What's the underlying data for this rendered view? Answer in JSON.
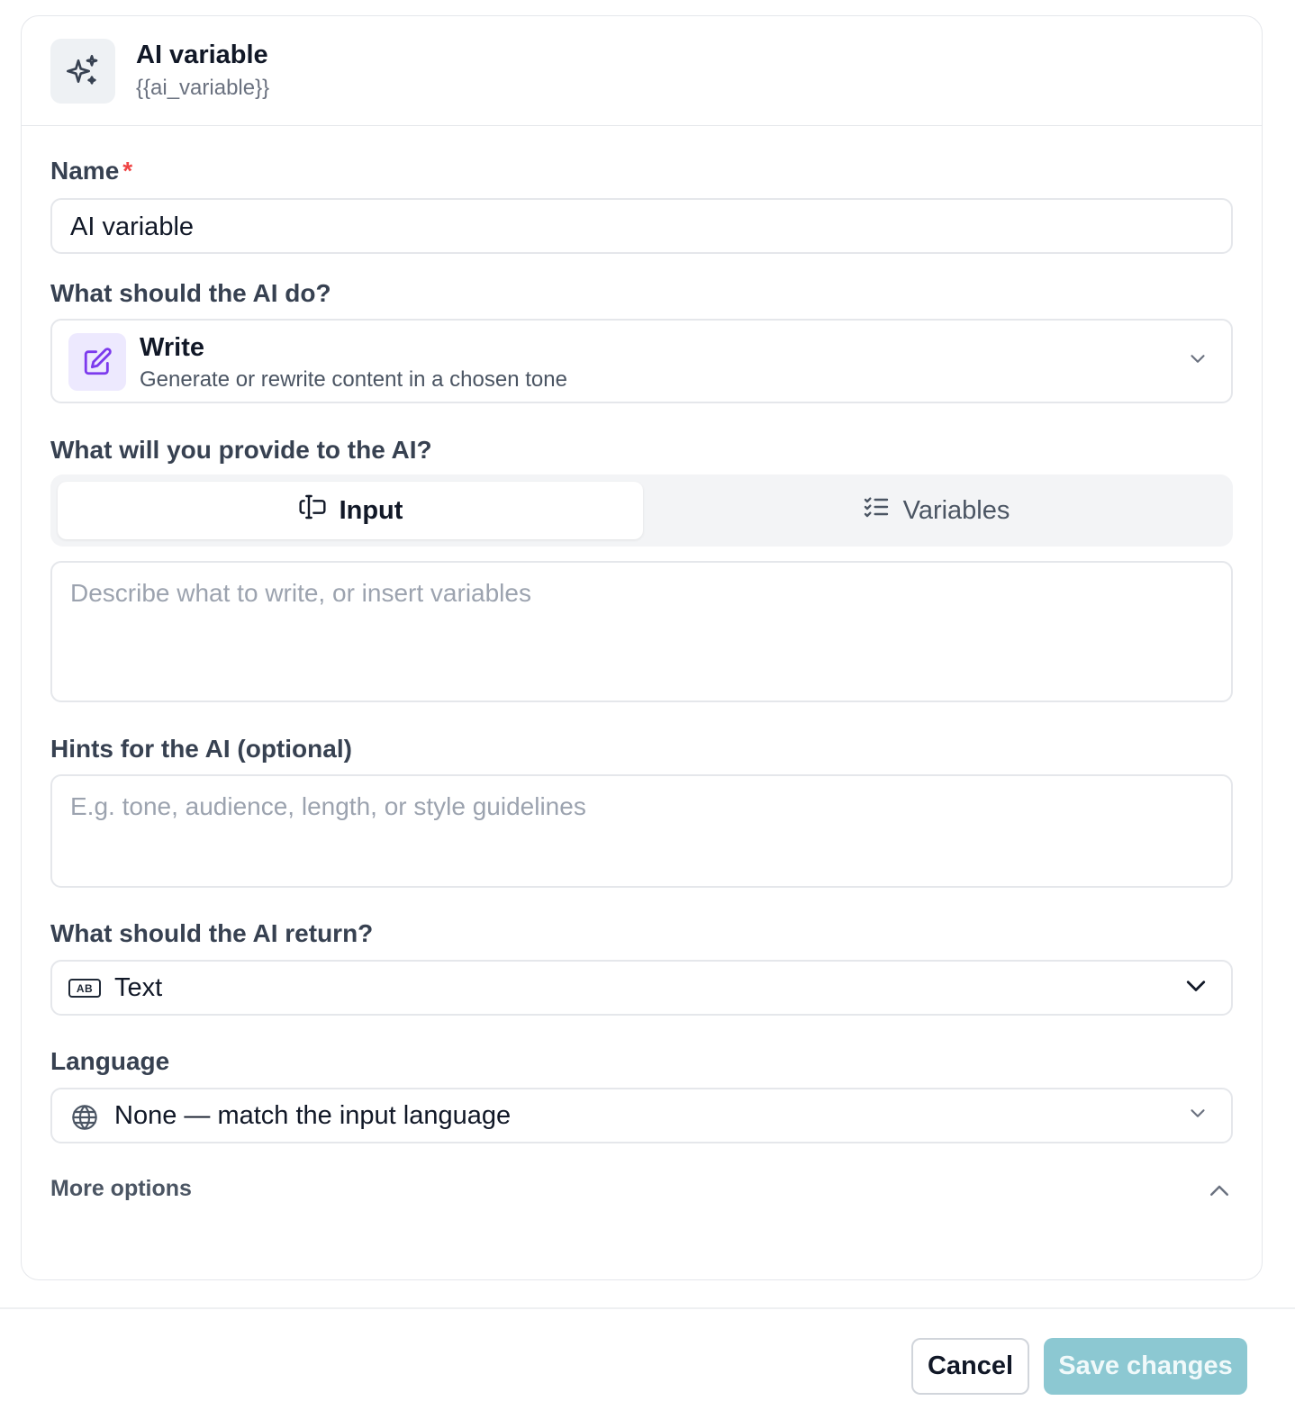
{
  "header": {
    "title": "AI variable",
    "subtitle": "{{ai_variable}}",
    "icon": "sparkles-icon"
  },
  "name_field": {
    "label": "Name",
    "required_mark": "*",
    "value": "AI variable"
  },
  "action_field": {
    "label": "What should the AI do?",
    "selected_title": "Write",
    "selected_description": "Generate or rewrite content in a chosen tone",
    "icon": "pencil-square-icon"
  },
  "provide_field": {
    "label": "What will you provide to the AI?",
    "tabs": [
      {
        "label": "Input",
        "icon": "text-cursor-input-icon",
        "active": true
      },
      {
        "label": "Variables",
        "icon": "list-checks-icon",
        "active": false
      }
    ],
    "placeholder": "Describe what to write, or insert variables"
  },
  "hints_field": {
    "label": "Hints for the AI (optional)",
    "placeholder": "E.g. tone, audience, length, or style guidelines"
  },
  "return_field": {
    "label": "What should the AI return?",
    "selected": "Text",
    "icon": "text-type-icon",
    "icon_text": "AB"
  },
  "language_field": {
    "label": "Language",
    "selected": "None — match the input language",
    "icon": "globe-icon"
  },
  "more_options": {
    "label": "More options"
  },
  "footer": {
    "cancel_label": "Cancel",
    "save_label": "Save changes"
  },
  "colors": {
    "accent_purple": "#7c3aed",
    "save_button_bg": "#8cc8d2",
    "required_red": "#ef4444"
  }
}
